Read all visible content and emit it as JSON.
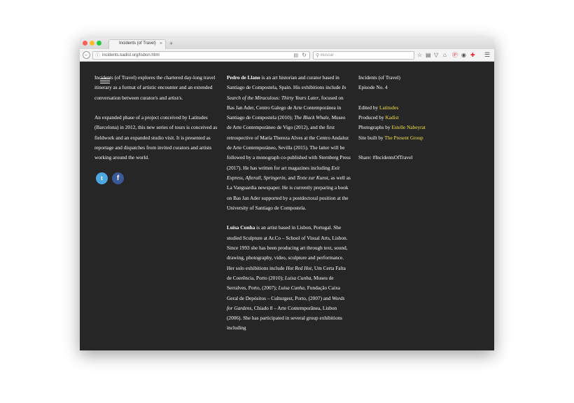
{
  "browser": {
    "tab_title": "Incidents (of Travel)",
    "tab_close": "×",
    "new_tab": "+",
    "url": "incidents.kadist.org/lisbon.html",
    "search_placeholder": "Buscar",
    "icons": [
      "back-icon",
      "info-icon",
      "reader-view-icon",
      "reload-icon",
      "search-icon",
      "bookmark-star-icon",
      "reading-list-icon",
      "pocket-icon",
      "home-icon",
      "pinterest-icon",
      "extension-icon",
      "addon-icon",
      "menu-icon"
    ]
  },
  "col1": {
    "intro_lead": "Incidents (of Travel)",
    "intro_rest": " explores the chartered day-long travel itinerary as a format of artistic encounter and an extended conversation between curator/s and artist/s.",
    "para2": "An expanded phase of a project conceived by Latitudes (Barcelona) in 2012, this new series of tours is conceived as fieldwork and an expanded studio visit. It is presented as reportage and dispatches from invited curators and artists working around the world.",
    "twitter_icon": "t",
    "facebook_icon": "f"
  },
  "col2": {
    "p1_name": "Pedro de Llano",
    "p1_a": " is an art historian and curator based in Santiago de Compostela, Spain. His exhibitions include ",
    "p1_i1": "In Search of the Miraculous: Thirty Years Later",
    "p1_b": ", focused on Bas Jan Ader, Centro Galego de Arte Contemporánea in Santiago de Compostela (2010); ",
    "p1_i2": "The Black Whale",
    "p1_c": ", Museo de Arte Contemporáneo de Vigo (2012), and the first retrospective of María Thereza Alves at the Centro Andaluz de Arte Contemporáneo, Sevilla (2015). The latter will be followed by a monograph co-published with Sternberg Press (2017). He has written for art magazines including ",
    "p1_i3": "Exit Express",
    "p1_d": ", ",
    "p1_i4": "Afterall",
    "p1_e": ", ",
    "p1_i5": "Springerin",
    "p1_f": ", and ",
    "p1_i6": "Texte zur Kunst",
    "p1_g": ", as well as La Vanguardia newspaper. He is currently preparing a book on Bas Jan Ader supported by a postdoctoral position at the University of Santiago de Compostela.",
    "p2_name": "Luisa Cunha",
    "p2_a": " is an artist based in Lisbon, Portugal. She studied Sculpture at Ar.Co – School of Visual Arts, Lisbon. Since 1993 she has been producing art through text, sound, drawing, photography, video, sculpture and performance. Her solo exhibitions include ",
    "p2_i1": "Hot Red Hot",
    "p2_b": ", Um Certa Falta de Coerência, Porto (2010); ",
    "p2_i2": "Luisa Cunha",
    "p2_c": ", Museu de Serralves, Porto, (2007); ",
    "p2_i3": "Luisa Cunha",
    "p2_d": ", Fundação Caixa Geral de Depósitos – Culturgest, Porto, (2007) and ",
    "p2_i4": "Words for Gardens",
    "p2_e": ", Chiado 8 – Arte Contemporânea, Lisbon (2006). She has participated in several group exhibitions including"
  },
  "col3": {
    "title": "Incidents (of Travel)",
    "episode": "Episode No. 4",
    "edited_label": "Edited by ",
    "edited_value": "Latitudes",
    "produced_label": "Produced by ",
    "produced_value": "Kadist",
    "photos_label": "Photographs by ",
    "photos_value": "Estelle Nabeyrat",
    "site_label": "Site built by ",
    "site_value": "The Present Group",
    "share": "Share: #IncidentsOfTravel"
  },
  "colors": {
    "page_bg": "#262626",
    "text": "#ffffff",
    "link": "#f5e04a",
    "twitter": "#4da7de",
    "facebook": "#3b5998"
  }
}
